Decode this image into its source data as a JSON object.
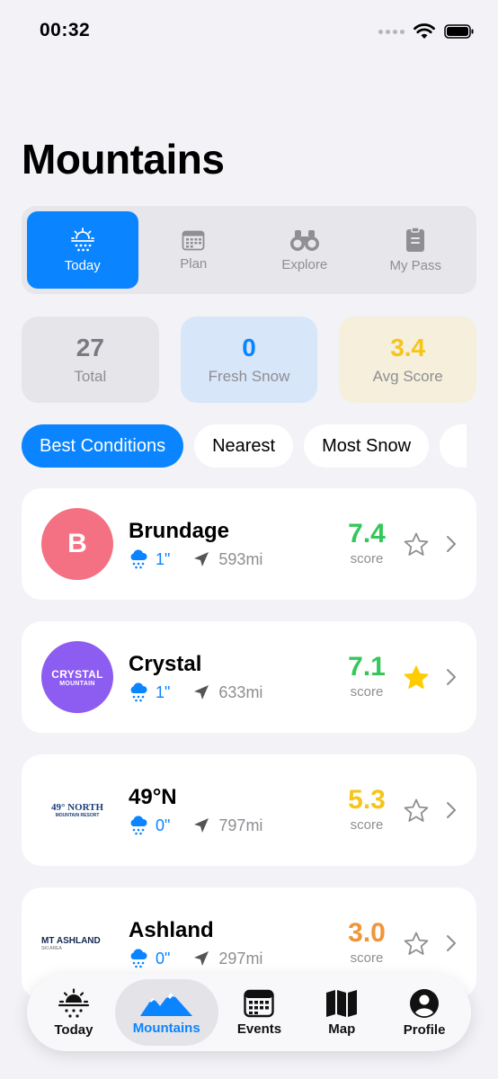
{
  "status_bar": {
    "time": "00:32"
  },
  "title": "Mountains",
  "tabs": [
    {
      "label": "Today",
      "icon": "sun-snow-icon",
      "active": true
    },
    {
      "label": "Plan",
      "icon": "calendar-icon",
      "active": false
    },
    {
      "label": "Explore",
      "icon": "binoculars-icon",
      "active": false
    },
    {
      "label": "My Pass",
      "icon": "pass-icon",
      "active": false
    }
  ],
  "stats": {
    "total": {
      "value": "27",
      "label": "Total"
    },
    "fresh_snow": {
      "value": "0",
      "label": "Fresh Snow"
    },
    "avg_score": {
      "value": "3.4",
      "label": "Avg Score"
    }
  },
  "filters": [
    {
      "label": "Best Conditions",
      "active": true
    },
    {
      "label": "Nearest",
      "active": false
    },
    {
      "label": "Most Snow",
      "active": false
    }
  ],
  "mountains": [
    {
      "name": "Brundage",
      "logo_text": "B",
      "snow": "1\"",
      "distance": "593mi",
      "score": "7.4",
      "score_label": "score",
      "score_color": "#34C759",
      "favorite": false
    },
    {
      "name": "Crystal",
      "logo_text": "CRYSTAL",
      "logo_sub": "MOUNTAIN",
      "snow": "1\"",
      "distance": "633mi",
      "score": "7.1",
      "score_label": "score",
      "score_color": "#34C759",
      "favorite": true
    },
    {
      "name": "49°N",
      "logo_text": "49° NORTH",
      "logo_sub": "MOUNTAIN RESORT",
      "snow": "0\"",
      "distance": "797mi",
      "score": "5.3",
      "score_label": "score",
      "score_color": "#F5C518",
      "favorite": false
    },
    {
      "name": "Ashland",
      "logo_text": "MT ASHLAND",
      "logo_sub": "SKI AREA",
      "snow": "0\"",
      "distance": "297mi",
      "score": "3.0",
      "score_label": "score",
      "score_color": "#F0953A",
      "favorite": false
    }
  ],
  "tabbar": [
    {
      "label": "Today",
      "icon": "sun-snow-icon",
      "active": false
    },
    {
      "label": "Mountains",
      "icon": "mountains-icon",
      "active": true
    },
    {
      "label": "Events",
      "icon": "calendar-icon",
      "active": false
    },
    {
      "label": "Map",
      "icon": "map-icon",
      "active": false
    },
    {
      "label": "Profile",
      "icon": "profile-icon",
      "active": false
    }
  ],
  "colors": {
    "accent": "#0A84FF",
    "background": "#F2F2F7",
    "star_active": "#FFCC00"
  }
}
